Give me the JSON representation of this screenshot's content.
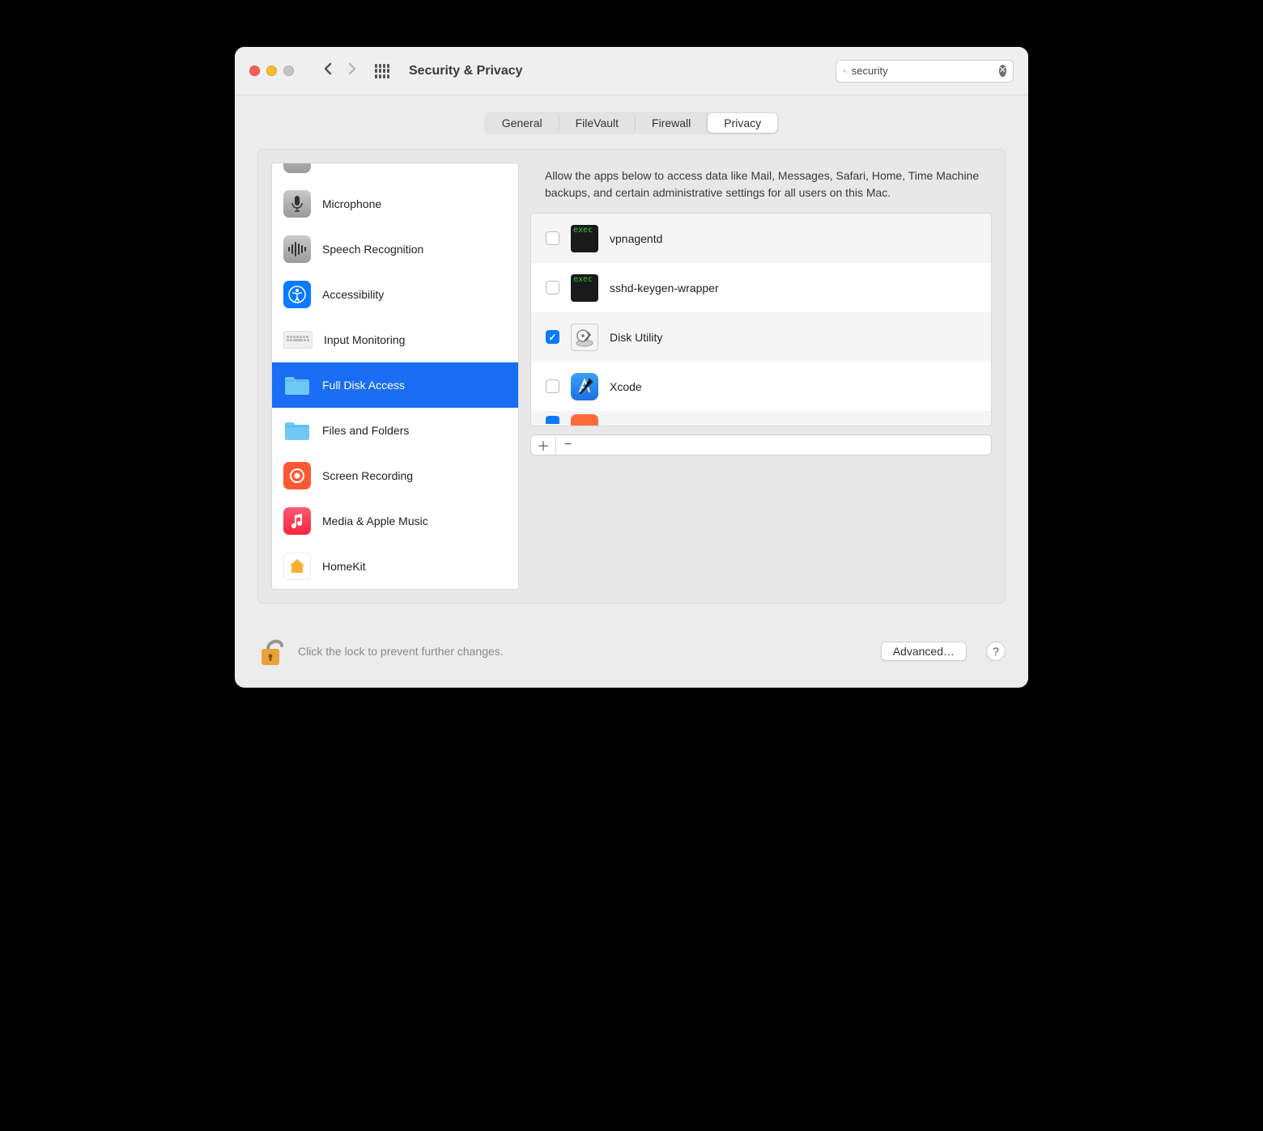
{
  "window": {
    "title": "Security & Privacy"
  },
  "search": {
    "value": "security"
  },
  "tabs": [
    {
      "label": "General",
      "active": false
    },
    {
      "label": "FileVault",
      "active": false
    },
    {
      "label": "Firewall",
      "active": false
    },
    {
      "label": "Privacy",
      "active": true
    }
  ],
  "sidebar": {
    "items": [
      {
        "label": "",
        "icon": "generic-gray",
        "selected": false
      },
      {
        "label": "Microphone",
        "icon": "microphone",
        "selected": false
      },
      {
        "label": "Speech Recognition",
        "icon": "waveform",
        "selected": false
      },
      {
        "label": "Accessibility",
        "icon": "accessibility",
        "selected": false
      },
      {
        "label": "Input Monitoring",
        "icon": "keyboard",
        "selected": false
      },
      {
        "label": "Full Disk Access",
        "icon": "folder",
        "selected": true
      },
      {
        "label": "Files and Folders",
        "icon": "folder",
        "selected": false
      },
      {
        "label": "Screen Recording",
        "icon": "record",
        "selected": false
      },
      {
        "label": "Media & Apple Music",
        "icon": "music",
        "selected": false
      },
      {
        "label": "HomeKit",
        "icon": "home",
        "selected": false
      }
    ]
  },
  "content": {
    "description": "Allow the apps below to access data like Mail, Messages, Safari, Home, Time Machine backups, and certain administrative settings for all users on this Mac.",
    "apps": [
      {
        "name": "vpnagentd",
        "checked": false,
        "icon": "terminal"
      },
      {
        "name": "sshd-keygen-wrapper",
        "checked": false,
        "icon": "terminal"
      },
      {
        "name": "Disk Utility",
        "checked": true,
        "icon": "disk-utility"
      },
      {
        "name": "Xcode",
        "checked": false,
        "icon": "xcode"
      }
    ]
  },
  "footer": {
    "lock_text": "Click the lock to prevent further changes.",
    "advanced_label": "Advanced…"
  }
}
